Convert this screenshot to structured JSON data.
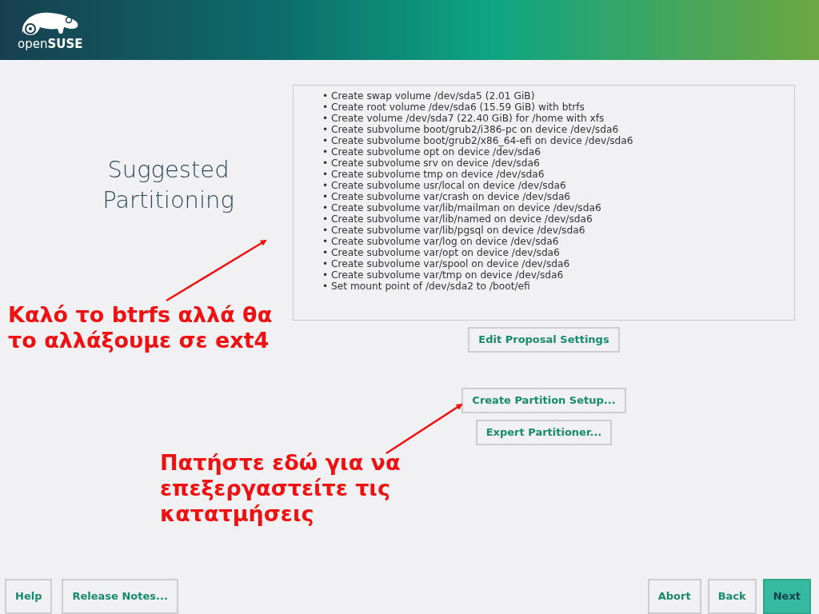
{
  "logo": {
    "text": "open**SUSE**"
  },
  "title_lines": [
    "Suggested",
    "Partitioning"
  ],
  "proposal": [
    "• Create swap volume /dev/sda5 (2.01 GiB)",
    "• Create root volume /dev/sda6 (15.59 GiB) with btrfs",
    "• Create volume /dev/sda7 (22.40 GiB) for /home with xfs",
    "• Create subvolume boot/grub2/i386-pc on device /dev/sda6",
    "• Create subvolume boot/grub2/x86_64-efi on device /dev/sda6",
    "• Create subvolume opt on device /dev/sda6",
    "• Create subvolume srv on device /dev/sda6",
    "• Create subvolume tmp on device /dev/sda6",
    "• Create subvolume usr/local on device /dev/sda6",
    "• Create subvolume var/crash on device /dev/sda6",
    "• Create subvolume var/lib/mailman on device /dev/sda6",
    "• Create subvolume var/lib/named on device /dev/sda6",
    "• Create subvolume var/lib/pgsql on device /dev/sda6",
    "• Create subvolume var/log on device /dev/sda6",
    "• Create subvolume var/opt on device /dev/sda6",
    "• Create subvolume var/spool on device /dev/sda6",
    "• Create subvolume var/tmp on device /dev/sda6",
    "• Set mount point of /dev/sda2 to /boot/efi"
  ],
  "actions": [
    {
      "label": "Edit Proposal Settings"
    },
    {
      "label": "Create Partition Setup..."
    },
    {
      "label": "Expert Partitioner..."
    }
  ],
  "annotations": [
    {
      "lines": [
        "Καλό το btrfs αλλά θα",
        "το αλλάξουμε σε ext4"
      ]
    },
    {
      "lines": [
        "Πατήστε εδώ για να",
        "επεξεργαστείτε τις",
        "κατατμήσεις"
      ]
    }
  ],
  "footer_left": [
    {
      "label": "Help",
      "primary": false
    },
    {
      "label": "Release Notes...",
      "primary": false
    }
  ],
  "footer_right": [
    {
      "label": "Abort",
      "primary": false
    },
    {
      "label": "Back",
      "primary": false
    },
    {
      "label": "Next",
      "primary": true
    }
  ]
}
